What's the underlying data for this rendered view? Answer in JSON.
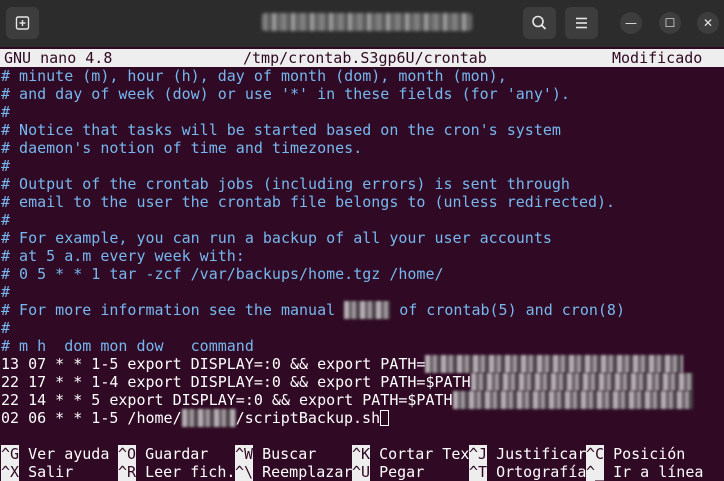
{
  "window": {
    "title_blurred": true,
    "buttons": {
      "minimize": "—",
      "maximize": "☐",
      "close": "✕"
    }
  },
  "nano": {
    "version": "GNU nano 4.8",
    "filename": "/tmp/crontab.S3gp6U/crontab",
    "status": "Modificado"
  },
  "lines": [
    {
      "text": "# minute (m), hour (h), day of month (dom), month (mon),"
    },
    {
      "text": "# and day of week (dow) or use '*' in these fields (for 'any')."
    },
    {
      "text": "#"
    },
    {
      "text": "# Notice that tasks will be started based on the cron's system"
    },
    {
      "text": "# daemon's notion of time and timezones."
    },
    {
      "text": "#"
    },
    {
      "text": "# Output of the crontab jobs (including errors) is sent through"
    },
    {
      "text": "# email to the user the crontab file belongs to (unless redirected)."
    },
    {
      "text": "#"
    },
    {
      "text": "# For example, you can run a backup of all your user accounts"
    },
    {
      "text": "# at 5 a.m every week with:"
    },
    {
      "text": "# 0 5 * * 1 tar -zcf /var/backups/home.tgz /home/"
    },
    {
      "text": "#"
    },
    {
      "text": "# For more information see the manual ",
      "after": " of crontab(5) and cron(8)"
    },
    {
      "text": "#"
    },
    {
      "text": "# m h  dom mon dow   command"
    },
    {
      "text": "13 07 * * 1-5 export DISPLAY=:0 && export PATH="
    },
    {
      "text": "22 17 * * 1-4 export DISPLAY=:0 && export PATH=$PATH"
    },
    {
      "text": "22 14 * * 5 export DISPLAY=:0 && export PATH=$PATH"
    },
    {
      "text": "02 06 * * 1-5 /home/",
      "after": "/scriptBackup.sh"
    }
  ],
  "shortcuts": {
    "row1": [
      {
        "key": "^G",
        "label": "Ver ayuda"
      },
      {
        "key": "^O",
        "label": "Guardar"
      },
      {
        "key": "^W",
        "label": "Buscar"
      },
      {
        "key": "^K",
        "label": "Cortar Tex"
      },
      {
        "key": "^J",
        "label": "Justificar"
      },
      {
        "key": "^C",
        "label": "Posición"
      }
    ],
    "row2": [
      {
        "key": "^X",
        "label": "Salir"
      },
      {
        "key": "^R",
        "label": "Leer fich."
      },
      {
        "key": "^\\",
        "label": "Reemplazar"
      },
      {
        "key": "^U",
        "label": "Pegar"
      },
      {
        "key": "^T",
        "label": "Ortografía"
      },
      {
        "key": "^_",
        "label": "Ir a línea"
      }
    ]
  },
  "colors": {
    "background": "#300a24",
    "comment": "#76b7ef",
    "text": "#ffffff",
    "bar": "#eeeeee"
  }
}
